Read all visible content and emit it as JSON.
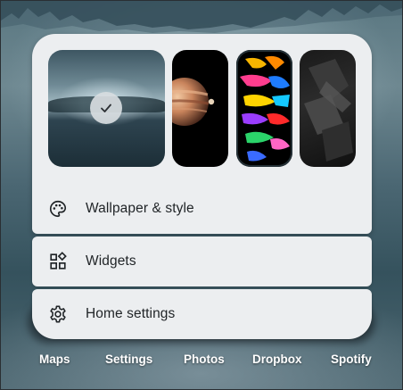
{
  "menu": {
    "wallpaper_label": "Wallpaper & style",
    "widgets_label": "Widgets",
    "home_settings_label": "Home settings"
  },
  "wallpapers": [
    {
      "name": "foggy-lake",
      "selected": true
    },
    {
      "name": "planet-moon",
      "selected": false
    },
    {
      "name": "paint-splash",
      "selected": false
    },
    {
      "name": "dark-abstract",
      "selected": false
    }
  ],
  "dock": {
    "apps": [
      "Maps",
      "Settings",
      "Photos",
      "Dropbox",
      "Spotify"
    ]
  }
}
